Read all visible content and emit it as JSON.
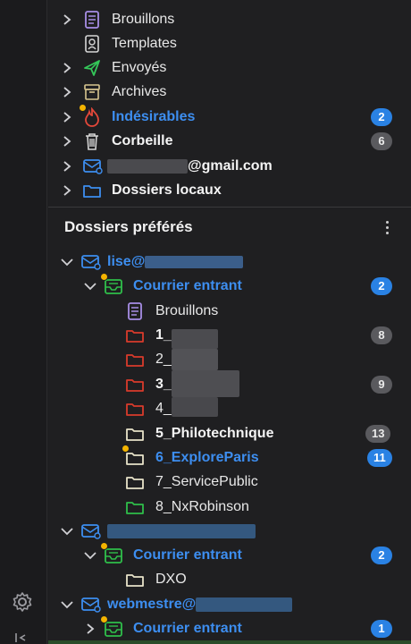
{
  "accounts_tree": [
    {
      "label": "Brouillons",
      "icon": "drafts-icon",
      "style": "normal"
    },
    {
      "label": "Templates",
      "icon": "templates-icon",
      "style": "normal"
    },
    {
      "label": "Envoyés",
      "icon": "sent-icon",
      "style": "normal"
    },
    {
      "label": "Archives",
      "icon": "archives-icon",
      "style": "normal"
    },
    {
      "label": "Indésirables",
      "icon": "junk-icon",
      "style": "blue",
      "badge": "2"
    },
    {
      "label": "Corbeille",
      "icon": "trash-icon",
      "style": "bold",
      "badge": "6"
    },
    {
      "label": "@gmail.com",
      "icon": "account-icon",
      "style": "bold"
    },
    {
      "label": "Dossiers locaux",
      "icon": "local-folders-icon",
      "style": "bold"
    }
  ],
  "favorites": {
    "title": "Dossiers préférés",
    "account1": {
      "label": "lise@"
    },
    "inbox1": {
      "label": "Courrier entrant",
      "badge": "2"
    },
    "folders": [
      {
        "label": "Brouillons"
      },
      {
        "label": "1_",
        "badge": "8"
      },
      {
        "label": "2_"
      },
      {
        "label": "3_",
        "badge": "9"
      },
      {
        "label": "4_"
      },
      {
        "label": "5_Philotechnique",
        "badge": "13"
      },
      {
        "label": "6_ExploreParis",
        "badge": "11"
      },
      {
        "label": "7_ServicePublic"
      },
      {
        "label": "8_NxRobinson"
      }
    ],
    "account2": {
      "label": ""
    },
    "inbox2": {
      "label": "Courrier entrant",
      "badge": "2"
    },
    "dxo": {
      "label": "DXO"
    },
    "account3": {
      "label": "webmestre@"
    },
    "inbox3": {
      "label": "Courrier entrant",
      "badge": "1"
    }
  },
  "colors": {
    "accent": "#2a82e4",
    "unread_text": "#3d8ef0",
    "badge_grey": "#5a5a5e",
    "folder_red": "#d93b2b",
    "folder_green": "#2fbf4a",
    "folder_neutral": "#e8e3c9"
  }
}
